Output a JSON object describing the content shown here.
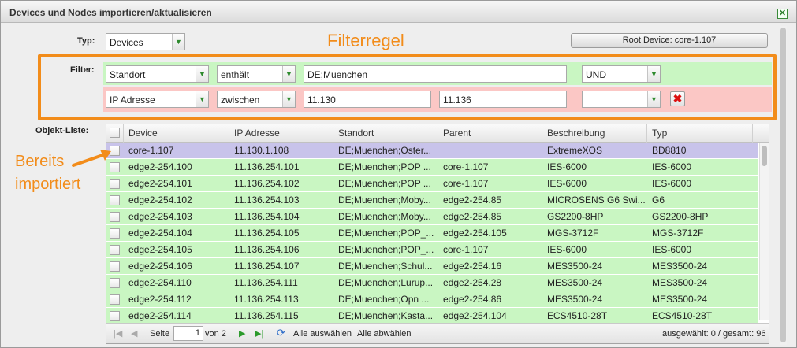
{
  "window": {
    "title": "Devices und Nodes importieren/aktualisieren",
    "close_label": "✕"
  },
  "typ": {
    "label": "Typ:",
    "value": "Devices"
  },
  "root_device_button": "Root Device: core-1.107",
  "annotations": {
    "filter_rule": "Filterregel",
    "already_imported_line1": "Bereits",
    "already_imported_line2": "importiert",
    "color": "#f28c1a"
  },
  "filter": {
    "label": "Filter:",
    "rows": [
      {
        "field": "Standort",
        "operator": "enthält",
        "value1": "DE;Muenchen",
        "value2": "",
        "logic": "UND",
        "color": "#c9f6c2"
      },
      {
        "field": "IP Adresse",
        "operator": "zwischen",
        "value1": "11.130",
        "value2": "11.136",
        "logic": "",
        "color": "#fbc7c5"
      }
    ]
  },
  "object_list": {
    "label": "Objekt-Liste:",
    "columns": [
      "Device",
      "IP Adresse",
      "Standort",
      "Parent",
      "Beschreibung",
      "Typ"
    ],
    "rows": [
      {
        "device": "core-1.107",
        "ip": "11.130.1.108",
        "standort": "DE;Muenchen;Oster...",
        "parent": "",
        "beschreibung": "ExtremeXOS",
        "typ": "BD8810",
        "status": "imported"
      },
      {
        "device": "edge2-254.100",
        "ip": "11.136.254.101",
        "standort": "DE;Muenchen;POP ...",
        "parent": "core-1.107",
        "beschreibung": "IES-6000",
        "typ": "IES-6000",
        "status": "new"
      },
      {
        "device": "edge2-254.101",
        "ip": "11.136.254.102",
        "standort": "DE;Muenchen;POP ...",
        "parent": "core-1.107",
        "beschreibung": "IES-6000",
        "typ": "IES-6000",
        "status": "new"
      },
      {
        "device": "edge2-254.102",
        "ip": "11.136.254.103",
        "standort": "DE;Muenchen;Moby...",
        "parent": "edge2-254.85",
        "beschreibung": "MICROSENS G6 Swi...",
        "typ": "G6",
        "status": "new"
      },
      {
        "device": "edge2-254.103",
        "ip": "11.136.254.104",
        "standort": "DE;Muenchen;Moby...",
        "parent": "edge2-254.85",
        "beschreibung": "GS2200-8HP",
        "typ": "GS2200-8HP",
        "status": "new"
      },
      {
        "device": "edge2-254.104",
        "ip": "11.136.254.105",
        "standort": "DE;Muenchen;POP_...",
        "parent": "edge2-254.105",
        "beschreibung": "MGS-3712F",
        "typ": "MGS-3712F",
        "status": "new"
      },
      {
        "device": "edge2-254.105",
        "ip": "11.136.254.106",
        "standort": "DE;Muenchen;POP_...",
        "parent": "core-1.107",
        "beschreibung": "IES-6000",
        "typ": "IES-6000",
        "status": "new"
      },
      {
        "device": "edge2-254.106",
        "ip": "11.136.254.107",
        "standort": "DE;Muenchen;Schul...",
        "parent": "edge2-254.16",
        "beschreibung": "MES3500-24",
        "typ": "MES3500-24",
        "status": "new"
      },
      {
        "device": "edge2-254.110",
        "ip": "11.136.254.111",
        "standort": "DE;Muenchen;Lurup...",
        "parent": "edge2-254.28",
        "beschreibung": "MES3500-24",
        "typ": "MES3500-24",
        "status": "new"
      },
      {
        "device": "edge2-254.112",
        "ip": "11.136.254.113",
        "standort": "DE;Muenchen;Opn ...",
        "parent": "edge2-254.86",
        "beschreibung": "MES3500-24",
        "typ": "MES3500-24",
        "status": "new"
      },
      {
        "device": "edge2-254.114",
        "ip": "11.136.254.115",
        "standort": "DE;Muenchen;Kasta...",
        "parent": "edge2-254.104",
        "beschreibung": "ECS4510-28T",
        "typ": "ECS4510-28T",
        "status": "new"
      }
    ],
    "row_colors": {
      "imported": "#c8c3ea",
      "new": "#c9f6c2"
    }
  },
  "pager": {
    "page_label": "Seite",
    "current_page": "1",
    "total_label": "von 2",
    "select_all": "Alle auswählen",
    "deselect_all": "Alle abwählen",
    "summary": "ausgewählt: 0 / gesamt: 96",
    "icons": [
      "first-page-icon",
      "prev-page-icon",
      "next-page-icon",
      "last-page-icon",
      "refresh-icon"
    ]
  }
}
